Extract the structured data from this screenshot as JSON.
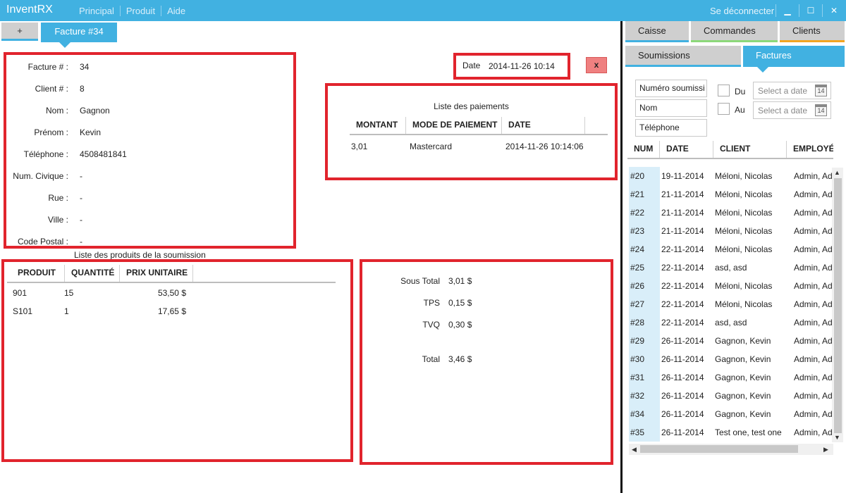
{
  "app": {
    "title": "InventRX",
    "menu": [
      "Principal",
      "Produit",
      "Aide"
    ],
    "logout": "Se déconnecter",
    "window_buttons": [
      "▁",
      "☐",
      "✕"
    ]
  },
  "tabs": {
    "plus": "+",
    "invoice": "Facture #34"
  },
  "client": {
    "fields": [
      {
        "label": "Facture # :",
        "value": "34"
      },
      {
        "label": "Client # :",
        "value": "8"
      },
      {
        "label": "Nom :",
        "value": "Gagnon"
      },
      {
        "label": "Prénom :",
        "value": "Kevin"
      },
      {
        "label": "Téléphone :",
        "value": "4508481841"
      },
      {
        "label": "Num. Civique :",
        "value": "-"
      },
      {
        "label": "Rue :",
        "value": "-"
      },
      {
        "label": "Ville :",
        "value": "-"
      },
      {
        "label": "Code Postal :",
        "value": "-"
      }
    ]
  },
  "date": {
    "label": "Date",
    "value": "2014-11-26 10:14"
  },
  "close_button": "x",
  "payments": {
    "title": "Liste des paiements",
    "columns": [
      "MONTANT",
      "MODE DE PAIEMENT",
      "DATE"
    ],
    "rows": [
      {
        "amount": "3,01",
        "mode": "Mastercard",
        "date": "2014-11-26 10:14:06"
      }
    ]
  },
  "products": {
    "title": "Liste des produits de la soumission",
    "columns": [
      "PRODUIT",
      "QUANTITÉ",
      "PRIX UNITAIRE"
    ],
    "rows": [
      {
        "product": "901",
        "qty": "15",
        "price": "53,50 $"
      },
      {
        "product": "S101",
        "qty": "1",
        "price": "17,65 $"
      }
    ]
  },
  "totals": {
    "subtotal": {
      "label": "Sous Total",
      "value": "3,01 $"
    },
    "tps": {
      "label": "TPS",
      "value": "0,15 $"
    },
    "tvq": {
      "label": "TVQ",
      "value": "0,30 $"
    },
    "total": {
      "label": "Total",
      "value": "3,46 $"
    }
  },
  "right_panel": {
    "tabs_row1": [
      "Caisse",
      "Commandes",
      "Clients"
    ],
    "tabs_row2": [
      "Soumissions",
      "Factures"
    ],
    "search": {
      "invoice_number": "Numéro soumissi",
      "name": "Nom",
      "phone": "Téléphone"
    },
    "filters": {
      "from_label": "Du",
      "to_label": "Au",
      "date_placeholder": "Select a date",
      "calendar_day": "14"
    },
    "columns": [
      "NUM",
      "DATE",
      "CLIENT",
      "EMPLOYÉ"
    ],
    "rows": [
      {
        "num": "#20",
        "date": "19-11-2014",
        "client": "Méloni, Nicolas",
        "employee": "Admin, Adm"
      },
      {
        "num": "#21",
        "date": "21-11-2014",
        "client": "Méloni, Nicolas",
        "employee": "Admin, Adm"
      },
      {
        "num": "#22",
        "date": "21-11-2014",
        "client": "Méloni, Nicolas",
        "employee": "Admin, Adm"
      },
      {
        "num": "#23",
        "date": "21-11-2014",
        "client": "Méloni, Nicolas",
        "employee": "Admin, Adm"
      },
      {
        "num": "#24",
        "date": "22-11-2014",
        "client": "Méloni, Nicolas",
        "employee": "Admin, Adm"
      },
      {
        "num": "#25",
        "date": "22-11-2014",
        "client": "asd, asd",
        "employee": "Admin, Adm"
      },
      {
        "num": "#26",
        "date": "22-11-2014",
        "client": "Méloni, Nicolas",
        "employee": "Admin, Adm"
      },
      {
        "num": "#27",
        "date": "22-11-2014",
        "client": "Méloni, Nicolas",
        "employee": "Admin, Adm"
      },
      {
        "num": "#28",
        "date": "22-11-2014",
        "client": "asd, asd",
        "employee": "Admin, Adm"
      },
      {
        "num": "#29",
        "date": "26-11-2014",
        "client": "Gagnon, Kevin",
        "employee": "Admin, Adm"
      },
      {
        "num": "#30",
        "date": "26-11-2014",
        "client": "Gagnon, Kevin",
        "employee": "Admin, Adm"
      },
      {
        "num": "#31",
        "date": "26-11-2014",
        "client": "Gagnon, Kevin",
        "employee": "Admin, Adm"
      },
      {
        "num": "#32",
        "date": "26-11-2014",
        "client": "Gagnon, Kevin",
        "employee": "Admin, Adm"
      },
      {
        "num": "#34",
        "date": "26-11-2014",
        "client": "Gagnon, Kevin",
        "employee": "Admin, Adm"
      },
      {
        "num": "#35",
        "date": "26-11-2014",
        "client": "Test one, test one",
        "employee": "Admin, Adm"
      }
    ]
  }
}
